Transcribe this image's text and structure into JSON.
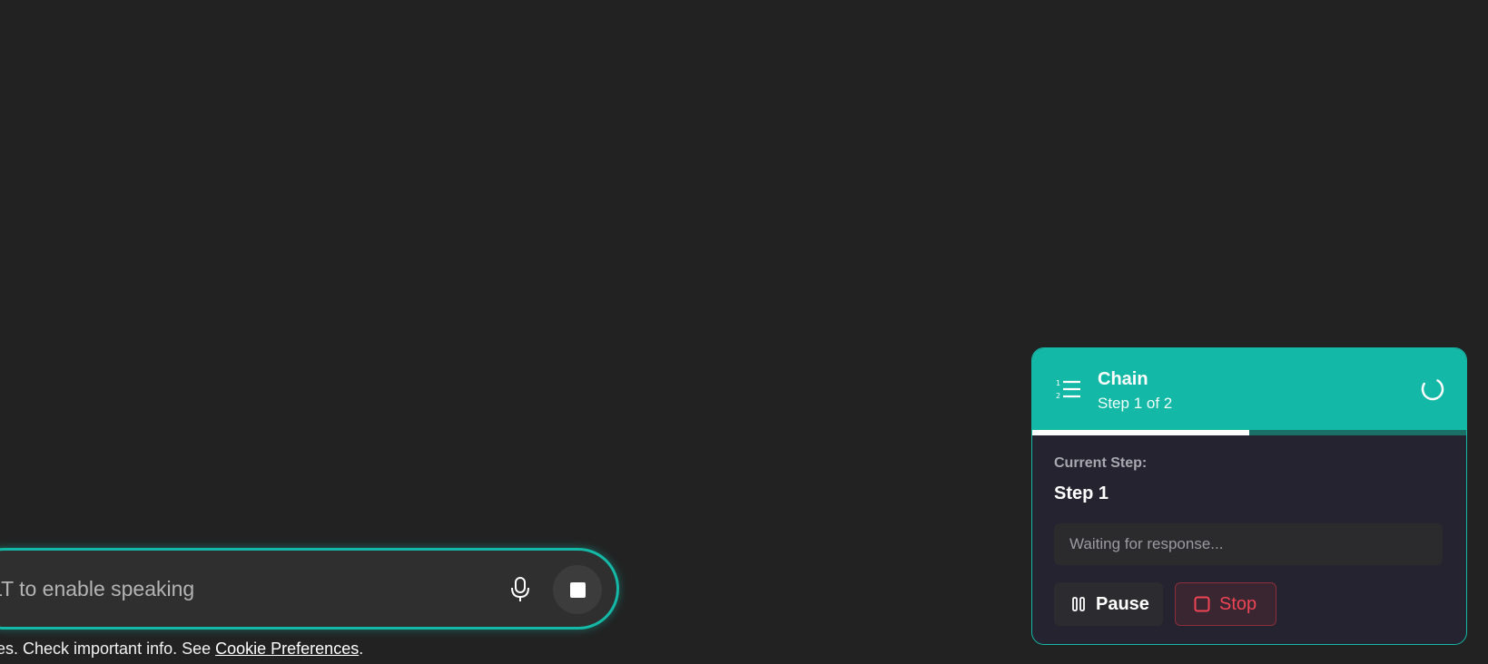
{
  "composer": {
    "placeholder": "LT to enable speaking",
    "mic_icon": "microphone-icon",
    "stop_icon": "stop-square-icon"
  },
  "disclaimer": {
    "text": "es. Check important info. See ",
    "link": "Cookie Preferences",
    "suffix": "."
  },
  "chain": {
    "title": "Chain",
    "subtitle": "Step 1 of 2",
    "progress": 0.5,
    "current_label": "Current Step:",
    "current_step": "Step 1",
    "response_status": "Waiting for response...",
    "pause_label": "Pause",
    "stop_label": "Stop",
    "accent_color": "#14b8a6",
    "stop_color": "#ef4455"
  }
}
